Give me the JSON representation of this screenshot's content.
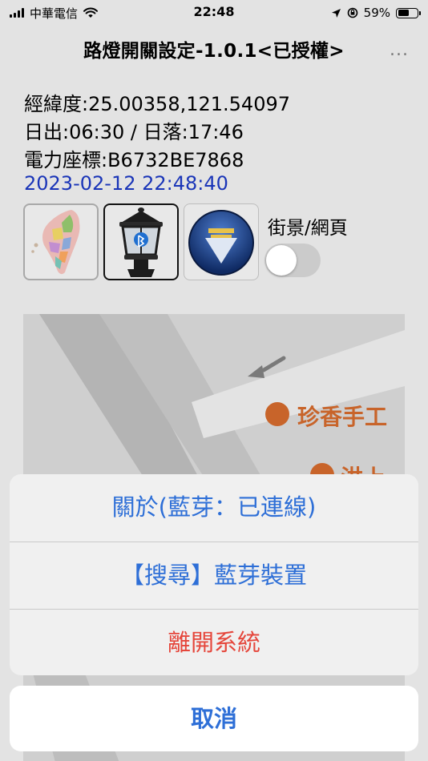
{
  "status_bar": {
    "carrier": "中華電信",
    "time": "22:48",
    "battery": "59%",
    "battery_level": 0.59
  },
  "nav": {
    "title": "路燈開關設定-1.0.1<已授權>",
    "more": "..."
  },
  "info": {
    "coordinates": "經緯度:25.00358,121.54097",
    "sun_times": "日出:06:30 / 日落:17:46",
    "power_id": "電力座標:B6732BE7868",
    "datetime": "2023-02-12 22:48:40"
  },
  "controls": {
    "streetview_label": "街景/網頁",
    "streetview_on": false
  },
  "map": {
    "poi_name": "珍香手工",
    "poi_partial": "洪上"
  },
  "action_sheet": {
    "about": "關於(藍芽：已連線)",
    "search_bluetooth": "【搜尋】藍芽裝置",
    "exit": "離開系統",
    "cancel": "取消"
  },
  "colors": {
    "action_blue": "#2e6fd7",
    "destructive_red": "#e5463b",
    "datetime_blue": "#1a35b8",
    "poi_orange": "#c8642a"
  }
}
